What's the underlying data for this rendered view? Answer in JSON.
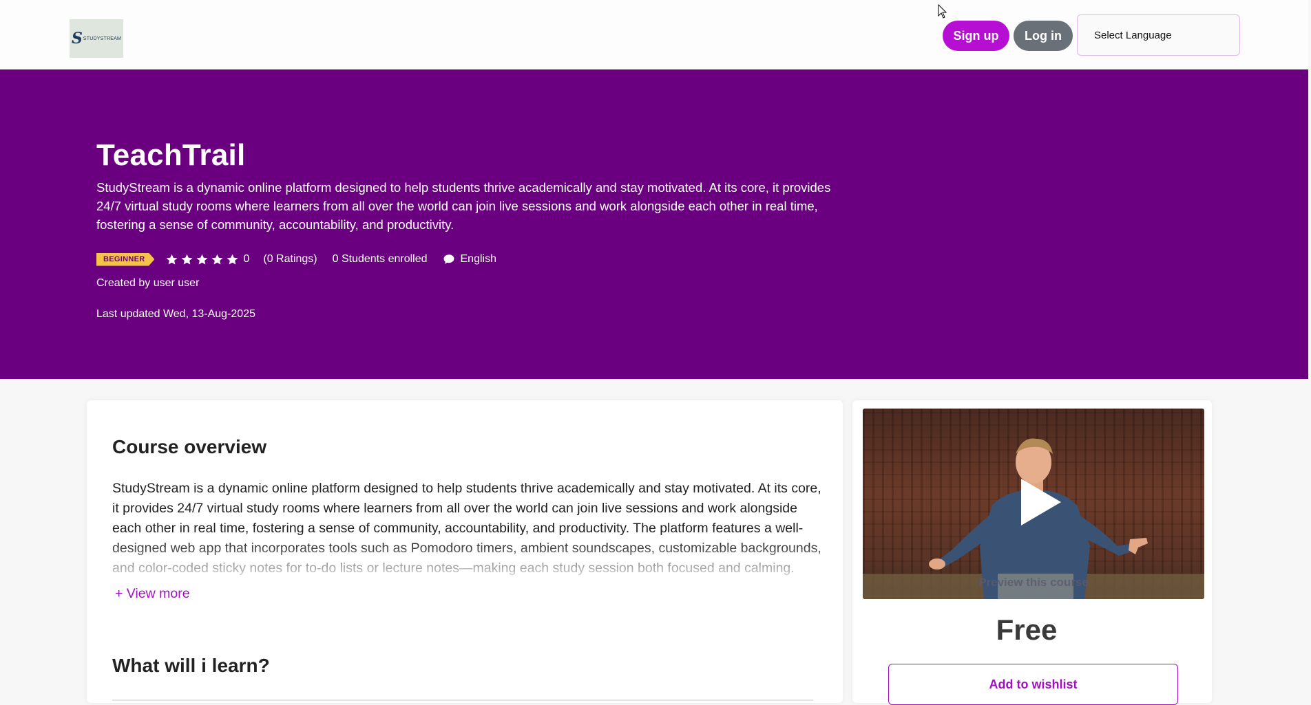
{
  "header": {
    "logo_text": "STUDYSTREAM",
    "signup_label": "Sign up",
    "login_label": "Log in",
    "language_select": "Select Language"
  },
  "hero": {
    "title": "TeachTrail",
    "description": "StudyStream is a dynamic online platform designed to help students thrive academically and stay motivated. At its core, it provides 24/7 virtual study rooms where learners from all over the world can join live sessions and work alongside each other in real time, fostering a sense of community, accountability, and productivity.",
    "level_badge": "BEGINNER",
    "rating_value": "0",
    "ratings_text": "(0 Ratings)",
    "students_text": "0 Students enrolled",
    "language": "English",
    "created_by": "Created by user user",
    "last_updated": "Last updated Wed, 13-Aug-2025"
  },
  "overview": {
    "title": "Course overview",
    "body": "StudyStream is a dynamic online platform designed to help students thrive academically and stay motivated. At its core, it provides 24/7 virtual study rooms where learners from all over the world can join live sessions and work alongside each other in real time, fostering a sense of community, accountability, and productivity. The platform features a well-designed web app that incorporates tools such as Pomodoro timers, ambient soundscapes, customizable backgrounds, and color-coded sticky notes for to-do lists or lecture notes—making each study session both focused and calming.",
    "view_more": "+ View more",
    "learn_title": "What will i learn?"
  },
  "sidebar": {
    "preview_label": "Preview this course",
    "price": "Free",
    "wishlist_label": "Add to wishlist"
  },
  "colors": {
    "brand_purple": "#6a0080",
    "signup_magenta": "#b70ed3",
    "login_gray": "#6a7077",
    "badge_yellow": "#f5c34a",
    "accent_link": "#a10fbf"
  },
  "icons": {
    "rating": "star-icon",
    "language": "chat-bubble-icon",
    "video": "play-icon"
  }
}
